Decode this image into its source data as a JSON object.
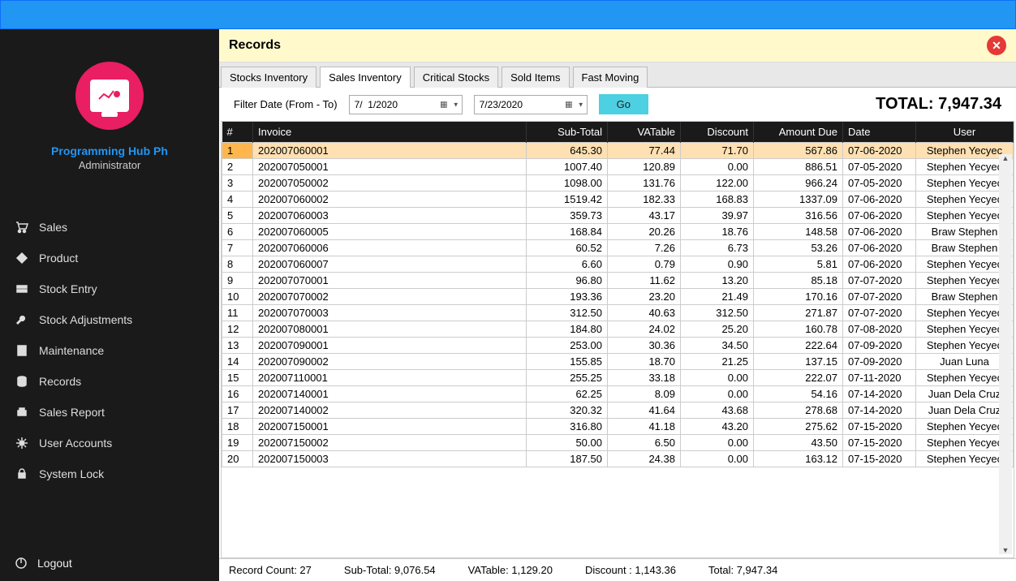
{
  "sidebar": {
    "brand": "Programming Hub Ph",
    "role": "Administrator",
    "items": [
      {
        "label": "Sales",
        "icon": "cart"
      },
      {
        "label": "Product",
        "icon": "tag"
      },
      {
        "label": "Stock Entry",
        "icon": "box"
      },
      {
        "label": "Stock Adjustments",
        "icon": "wrench"
      },
      {
        "label": "Maintenance",
        "icon": "clipboard"
      },
      {
        "label": "Records",
        "icon": "database"
      },
      {
        "label": "Sales Report",
        "icon": "printer"
      },
      {
        "label": "User Accounts",
        "icon": "gear"
      },
      {
        "label": "System Lock",
        "icon": "lock"
      }
    ],
    "logout": "Logout"
  },
  "header": {
    "title": "Records"
  },
  "tabs": {
    "items": [
      "Stocks Inventory",
      "Sales Inventory",
      "Critical Stocks",
      "Sold Items",
      "Fast Moving"
    ],
    "active": 1
  },
  "filter": {
    "label": "Filter Date (From - To)",
    "from": "7/  1/2020",
    "to": "7/23/2020",
    "go": "Go"
  },
  "total_label": "TOTAL: 7,947.34",
  "columns": [
    "#",
    "Invoice",
    "Sub-Total",
    "VATable",
    "Discount",
    "Amount Due",
    "Date",
    "User"
  ],
  "rows": [
    {
      "n": "1",
      "invoice": "202007060001",
      "sub": "645.30",
      "vat": "77.44",
      "disc": "71.70",
      "amt": "567.86",
      "date": "07-06-2020",
      "user": "Stephen Yecyec"
    },
    {
      "n": "2",
      "invoice": "202007050001",
      "sub": "1007.40",
      "vat": "120.89",
      "disc": "0.00",
      "amt": "886.51",
      "date": "07-05-2020",
      "user": "Stephen Yecyec"
    },
    {
      "n": "3",
      "invoice": "202007050002",
      "sub": "1098.00",
      "vat": "131.76",
      "disc": "122.00",
      "amt": "966.24",
      "date": "07-05-2020",
      "user": "Stephen Yecyec"
    },
    {
      "n": "4",
      "invoice": "202007060002",
      "sub": "1519.42",
      "vat": "182.33",
      "disc": "168.83",
      "amt": "1337.09",
      "date": "07-06-2020",
      "user": "Stephen Yecyec"
    },
    {
      "n": "5",
      "invoice": "202007060003",
      "sub": "359.73",
      "vat": "43.17",
      "disc": "39.97",
      "amt": "316.56",
      "date": "07-06-2020",
      "user": "Stephen Yecyec"
    },
    {
      "n": "6",
      "invoice": "202007060005",
      "sub": "168.84",
      "vat": "20.26",
      "disc": "18.76",
      "amt": "148.58",
      "date": "07-06-2020",
      "user": "Braw Stephen"
    },
    {
      "n": "7",
      "invoice": "202007060006",
      "sub": "60.52",
      "vat": "7.26",
      "disc": "6.73",
      "amt": "53.26",
      "date": "07-06-2020",
      "user": "Braw Stephen"
    },
    {
      "n": "8",
      "invoice": "202007060007",
      "sub": "6.60",
      "vat": "0.79",
      "disc": "0.90",
      "amt": "5.81",
      "date": "07-06-2020",
      "user": "Stephen Yecyec"
    },
    {
      "n": "9",
      "invoice": "202007070001",
      "sub": "96.80",
      "vat": "11.62",
      "disc": "13.20",
      "amt": "85.18",
      "date": "07-07-2020",
      "user": "Stephen Yecyec"
    },
    {
      "n": "10",
      "invoice": "202007070002",
      "sub": "193.36",
      "vat": "23.20",
      "disc": "21.49",
      "amt": "170.16",
      "date": "07-07-2020",
      "user": "Braw Stephen"
    },
    {
      "n": "11",
      "invoice": "202007070003",
      "sub": "312.50",
      "vat": "40.63",
      "disc": "312.50",
      "amt": "271.87",
      "date": "07-07-2020",
      "user": "Stephen Yecyec"
    },
    {
      "n": "12",
      "invoice": "202007080001",
      "sub": "184.80",
      "vat": "24.02",
      "disc": "25.20",
      "amt": "160.78",
      "date": "07-08-2020",
      "user": "Stephen Yecyec"
    },
    {
      "n": "13",
      "invoice": "202007090001",
      "sub": "253.00",
      "vat": "30.36",
      "disc": "34.50",
      "amt": "222.64",
      "date": "07-09-2020",
      "user": "Stephen Yecyec"
    },
    {
      "n": "14",
      "invoice": "202007090002",
      "sub": "155.85",
      "vat": "18.70",
      "disc": "21.25",
      "amt": "137.15",
      "date": "07-09-2020",
      "user": "Juan Luna"
    },
    {
      "n": "15",
      "invoice": "202007110001",
      "sub": "255.25",
      "vat": "33.18",
      "disc": "0.00",
      "amt": "222.07",
      "date": "07-11-2020",
      "user": "Stephen Yecyec"
    },
    {
      "n": "16",
      "invoice": "202007140001",
      "sub": "62.25",
      "vat": "8.09",
      "disc": "0.00",
      "amt": "54.16",
      "date": "07-14-2020",
      "user": "Juan Dela Cruz"
    },
    {
      "n": "17",
      "invoice": "202007140002",
      "sub": "320.32",
      "vat": "41.64",
      "disc": "43.68",
      "amt": "278.68",
      "date": "07-14-2020",
      "user": "Juan Dela Cruz"
    },
    {
      "n": "18",
      "invoice": "202007150001",
      "sub": "316.80",
      "vat": "41.18",
      "disc": "43.20",
      "amt": "275.62",
      "date": "07-15-2020",
      "user": "Stephen Yecyec"
    },
    {
      "n": "19",
      "invoice": "202007150002",
      "sub": "50.00",
      "vat": "6.50",
      "disc": "0.00",
      "amt": "43.50",
      "date": "07-15-2020",
      "user": "Stephen Yecyec"
    },
    {
      "n": "20",
      "invoice": "202007150003",
      "sub": "187.50",
      "vat": "24.38",
      "disc": "0.00",
      "amt": "163.12",
      "date": "07-15-2020",
      "user": "Stephen Yecyec"
    }
  ],
  "footer": {
    "count": "Record Count: 27",
    "sub": "Sub-Total: 9,076.54",
    "vat": "VATable: 1,129.20",
    "disc": "Discount : 1,143.36",
    "total": "Total: 7,947.34"
  }
}
